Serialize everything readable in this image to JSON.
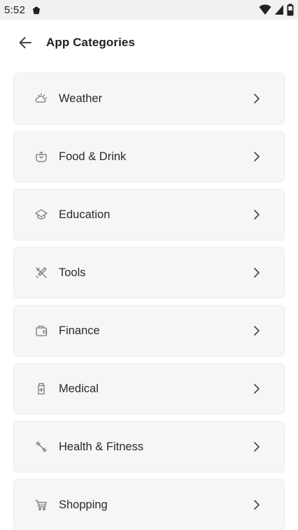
{
  "status_bar": {
    "time": "5:52"
  },
  "header": {
    "title": "App Categories"
  },
  "categories": [
    {
      "label": "Weather",
      "icon": "weather-icon"
    },
    {
      "label": "Food & Drink",
      "icon": "food-icon"
    },
    {
      "label": "Education",
      "icon": "education-icon"
    },
    {
      "label": "Tools",
      "icon": "tools-icon"
    },
    {
      "label": "Finance",
      "icon": "finance-icon"
    },
    {
      "label": "Medical",
      "icon": "medical-icon"
    },
    {
      "label": "Health & Fitness",
      "icon": "fitness-icon"
    },
    {
      "label": "Shopping",
      "icon": "shopping-icon"
    }
  ]
}
